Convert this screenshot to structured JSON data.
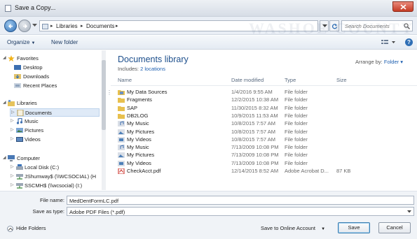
{
  "window": {
    "title": "Save a Copy...",
    "watermark": "WASHOE COUNTY"
  },
  "address": {
    "crumbs": [
      "Libraries",
      "Documents"
    ],
    "search_placeholder": "Search Documents"
  },
  "toolbar": {
    "organize_label": "Organize",
    "new_folder_label": "New folder"
  },
  "navigation": {
    "favorites_label": "Favorites",
    "favorites": [
      "Desktop",
      "Downloads",
      "Recent Places"
    ],
    "libraries_label": "Libraries",
    "libraries": [
      "Documents",
      "Music",
      "Pictures",
      "Videos"
    ],
    "computer_label": "Computer",
    "drives": [
      "Local Disk (C:)",
      "JShumway$ (\\\\WCSOCIAL) (H",
      "SSCMH$ (\\\\wcsocial) (I:)"
    ],
    "selected": "Documents"
  },
  "library": {
    "title": "Documents library",
    "includes_prefix": "Includes:",
    "includes_link": "2 locations",
    "arrange_by_label": "Arrange by:",
    "arrange_by_value": "Folder"
  },
  "columns": {
    "name": "Name",
    "date": "Date modified",
    "type": "Type",
    "size": "Size"
  },
  "files": [
    {
      "name": "My Data Sources",
      "date": "1/4/2016 9:55 AM",
      "type": "File folder",
      "size": "",
      "icon": "folder-datasource-icon"
    },
    {
      "name": "Fragments",
      "date": "12/2/2015 10:38 AM",
      "type": "File folder",
      "size": "",
      "icon": "folder-icon"
    },
    {
      "name": "SAP",
      "date": "11/30/2015 8:32 AM",
      "type": "File folder",
      "size": "",
      "icon": "folder-icon"
    },
    {
      "name": "DB2LOG",
      "date": "10/9/2015 11:53 AM",
      "type": "File folder",
      "size": "",
      "icon": "folder-icon"
    },
    {
      "name": "My Music",
      "date": "10/8/2015 7:57 AM",
      "type": "File folder",
      "size": "",
      "icon": "music-folder-icon"
    },
    {
      "name": "My Pictures",
      "date": "10/8/2015 7:57 AM",
      "type": "File folder",
      "size": "",
      "icon": "pictures-folder-icon"
    },
    {
      "name": "My Videos",
      "date": "10/8/2015 7:57 AM",
      "type": "File folder",
      "size": "",
      "icon": "videos-folder-icon"
    },
    {
      "name": "My Music",
      "date": "7/13/2009 10:08 PM",
      "type": "File folder",
      "size": "",
      "icon": "music-folder-icon"
    },
    {
      "name": "My Pictures",
      "date": "7/13/2009 10:08 PM",
      "type": "File folder",
      "size": "",
      "icon": "pictures-folder-icon"
    },
    {
      "name": "My Videos",
      "date": "7/13/2009 10:08 PM",
      "type": "File folder",
      "size": "",
      "icon": "videos-folder-icon"
    },
    {
      "name": "CheckAcct.pdf",
      "date": "12/14/2015 8:52 AM",
      "type": "Adobe Acrobat D...",
      "size": "87 KB",
      "icon": "pdf-icon"
    }
  ],
  "form": {
    "file_name_label": "File name:",
    "file_name_value": "MedDentFormLC.pdf",
    "save_type_label": "Save as type:",
    "save_type_value": "Adobe PDF Files (*.pdf)"
  },
  "footer": {
    "hide_folders_label": "Hide Folders",
    "save_online_label": "Save to Online Account",
    "save_label": "Save",
    "cancel_label": "Cancel"
  },
  "colors": {
    "accent": "#1d4f8c",
    "link": "#1d5fb0",
    "close": "#c43b24",
    "selection": "#dfeaf7"
  }
}
